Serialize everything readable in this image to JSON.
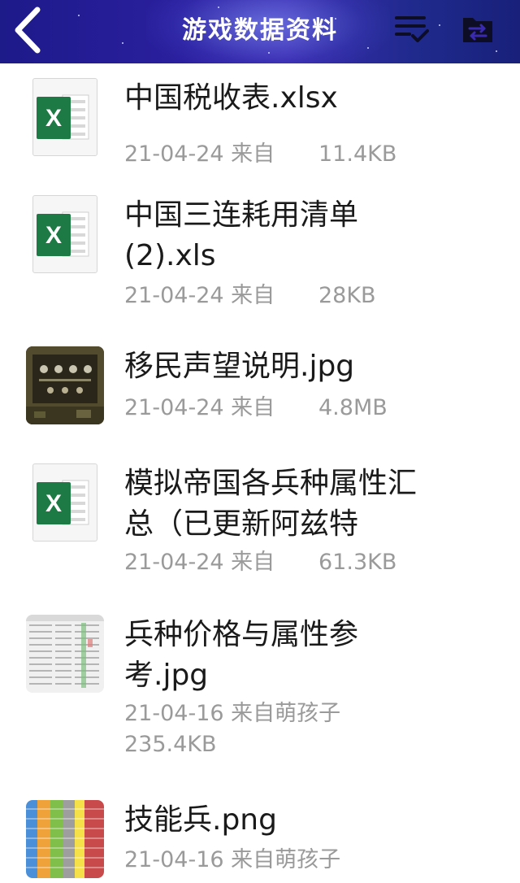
{
  "navbar": {
    "title": "游戏数据资料",
    "back_icon": "chevron-left-icon",
    "sort_icon": "sort-list-check-icon",
    "folder_icon": "folder-transfer-icon",
    "background_colors": [
      "#1d1a8a",
      "#3a2ab0",
      "#18207a"
    ]
  },
  "files": [
    {
      "name": "中国税收表.xlsx",
      "date_source": "21-04-24 来自",
      "size": "11.4KB",
      "type": "excel-icon"
    },
    {
      "name": "中国三连耗用清单(2).xls",
      "date_source": "21-04-24 来自",
      "size": "28KB",
      "type": "excel-icon"
    },
    {
      "name": "移民声望说明.jpg",
      "date_source": "21-04-24 来自",
      "size": "4.8MB",
      "type": "image-thumbnail"
    },
    {
      "name": "模拟帝国各兵种属性汇总（已更新阿兹特",
      "date_source": "21-04-24 来自",
      "size": "61.3KB",
      "type": "excel-icon"
    },
    {
      "name": "兵种价格与属性参考.jpg",
      "date_source": "21-04-16 来自萌孩子",
      "size": "235.4KB",
      "type": "image-thumbnail"
    },
    {
      "name": "技能兵.png",
      "date_source": "21-04-16 来自萌孩子",
      "size": "",
      "type": "image-thumbnail"
    }
  ],
  "colors": {
    "excel_green": "#1e7a45",
    "meta_gray": "#9a9a9a",
    "name_black": "#1a1a1a"
  }
}
